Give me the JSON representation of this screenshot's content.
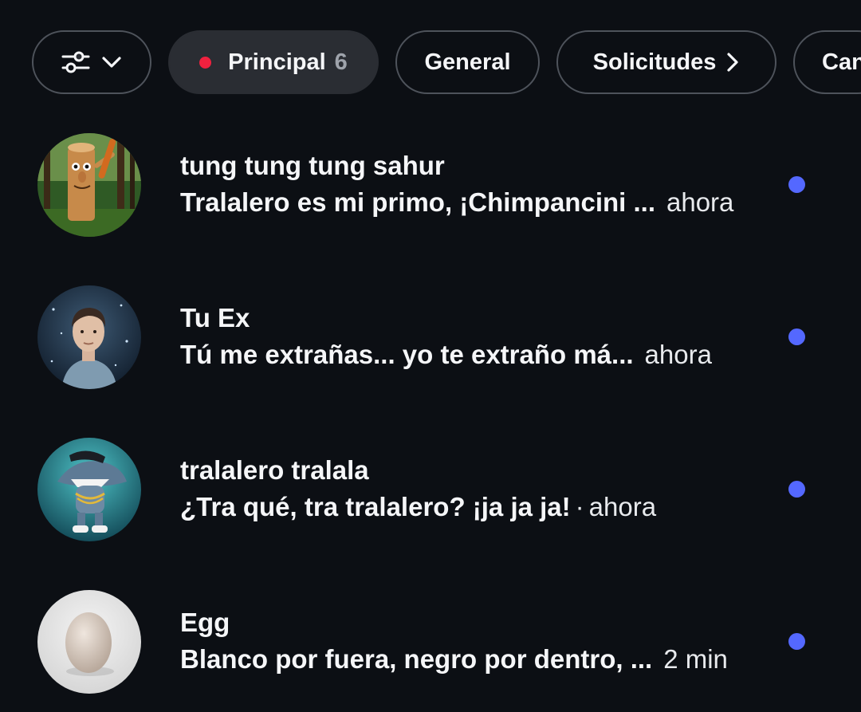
{
  "tabs": {
    "primary_label": "Principal",
    "primary_count": "6",
    "general_label": "General",
    "requests_label": "Solicitudes",
    "channels_label": "Can"
  },
  "colors": {
    "background": "#0c0f14",
    "unread_dot": "#5468ff",
    "notification_dot": "#f0213f",
    "pill_border": "#4e535b",
    "active_pill": "#2a2d33"
  },
  "conversations": [
    {
      "name": "tung tung tung sahur",
      "message": "Tralalero es mi primo, ¡Chimpancini ...",
      "time": "ahora",
      "unread": true
    },
    {
      "name": "Tu Ex",
      "message": "Tú me extrañas... yo te extraño má...",
      "time": "ahora",
      "unread": true
    },
    {
      "name": "tralalero tralala",
      "message": "¿Tra qué, tra tralalero? ¡ja ja ja!",
      "separator": "·",
      "time": "ahora",
      "unread": true
    },
    {
      "name": "Egg",
      "message": "Blanco por fuera, negro por dentro, ...",
      "time": "2 min",
      "unread": true
    }
  ]
}
